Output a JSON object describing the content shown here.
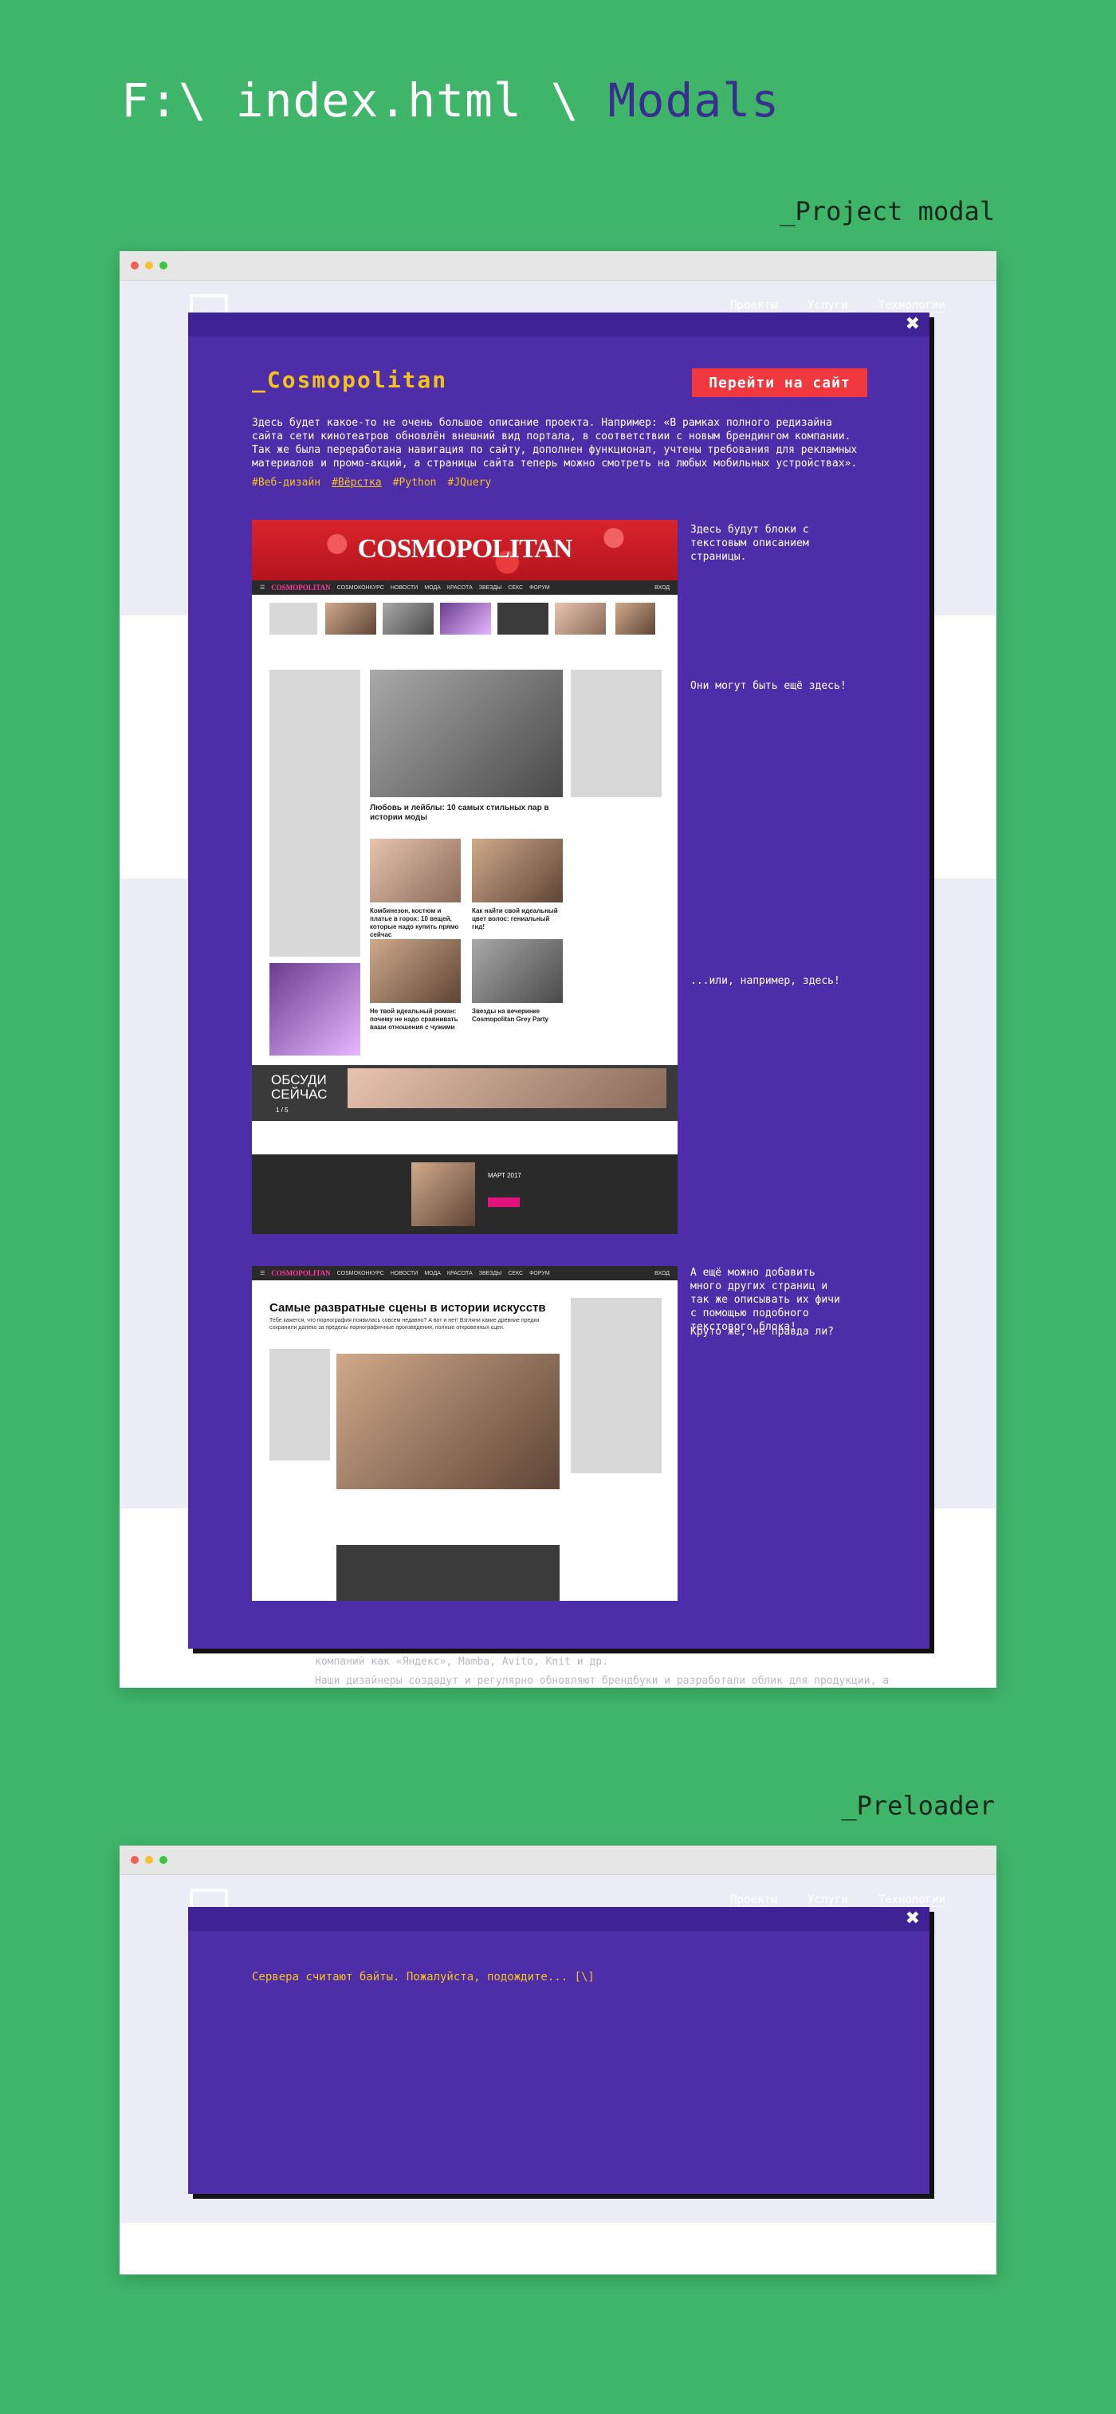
{
  "page": {
    "path_prefix": "F:\\ index.html \\",
    "path_current": "Modals",
    "background": "#3fb56a",
    "accent": "#3a2f8f"
  },
  "project_section": {
    "label": "_Project modal",
    "site_nav": [
      "Проекты",
      "Услуги",
      "Технологии"
    ],
    "behind_lines": [
      "компаний как «Яндекс», Mamba, Avito, Knit и др.",
      "Наши дизайнеры создадут и регулярно обновляют брендбуки и разработали облик для продукции, а"
    ],
    "modal": {
      "close_label": "✖",
      "title": "_Cosmopolitan",
      "button_label": "Перейти на сайт",
      "description": "Здесь будет какое-то не очень большое описание проекта. Например: «В рамках полного редизайна сайта сети кинотеатров обновлён внешний вид портала, в соответствии с новым брендингом компании. Так же была переработана навигация по сайту, дополнен функционал, учтены требования для рекламных материалов и промо-акций, а страницы сайта теперь можно смотреть на любых мобильных устройствах».",
      "tags": [
        "#Веб-дизайн",
        "#Вёрстка",
        "#Python",
        "#JQuery"
      ],
      "active_tag_index": 1,
      "side_notes": [
        "Здесь будут блоки с текстовым описанием страницы.",
        "Они могут быть ещё здесь!",
        "...или, например, здесь!",
        "А ещё можно добавить много других страниц и так же описывать их фичи с помощью подобного текстового блока!",
        "Круто же, не правда ли?"
      ]
    },
    "screenshot_1": {
      "logo": "COSMOPOLITAN",
      "nav_brand": "COSMOPOLITAN",
      "nav_items": [
        "COSMOКОНКУРС",
        "НОВОСТИ",
        "МОДА",
        "КРАСОТА",
        "ЗВЕЗДЫ",
        "СЕКС",
        "ФОРУМ"
      ],
      "nav_login": "ВХОД",
      "headline_main": "Любовь и лейблы: 10 самых стильных пар в истории моды",
      "headline_a": "Комбинезон, костюм и платье в горох: 10 вещей, которые надо купить прямо сейчас",
      "headline_b": "Как найти свой идеальный цвет волос: гениальный гид!",
      "headline_c": "Не твой идеальный роман: почему не надо сравнивать ваши отношения с чужими",
      "headline_d": "Звезды на вечеринке Cosmopolitan Grey Party",
      "discuss_label": "ОБСУДИ\nСЕЙЧАС",
      "discuss_pager": "1 / 5",
      "issue_label": "МАРТ 2017"
    },
    "screenshot_2": {
      "nav_brand": "COSMOPOLITAN",
      "nav_items": [
        "COSMOКОНКУРС",
        "НОВОСТИ",
        "МОДА",
        "КРАСОТА",
        "ЗВЕЗДЫ",
        "СЕКС",
        "ФОРУМ"
      ],
      "nav_login": "ВХОД",
      "title": "Самые развратные сцены в истории искусств",
      "lead": "Тебе кажется, что порнография появилась совсем недавно? А вот и нет! Взгляни какие древние предки сохранили далеко за пределы порнографичные произведения, полные откровенных сцен."
    }
  },
  "preloader_section": {
    "label": "_Preloader",
    "site_nav": [
      "Проекты",
      "Услуги",
      "Технологии"
    ],
    "modal": {
      "close_label": "✖",
      "text": "Сервера считают байты. Пожалуйста, подождите... [\\]"
    }
  }
}
